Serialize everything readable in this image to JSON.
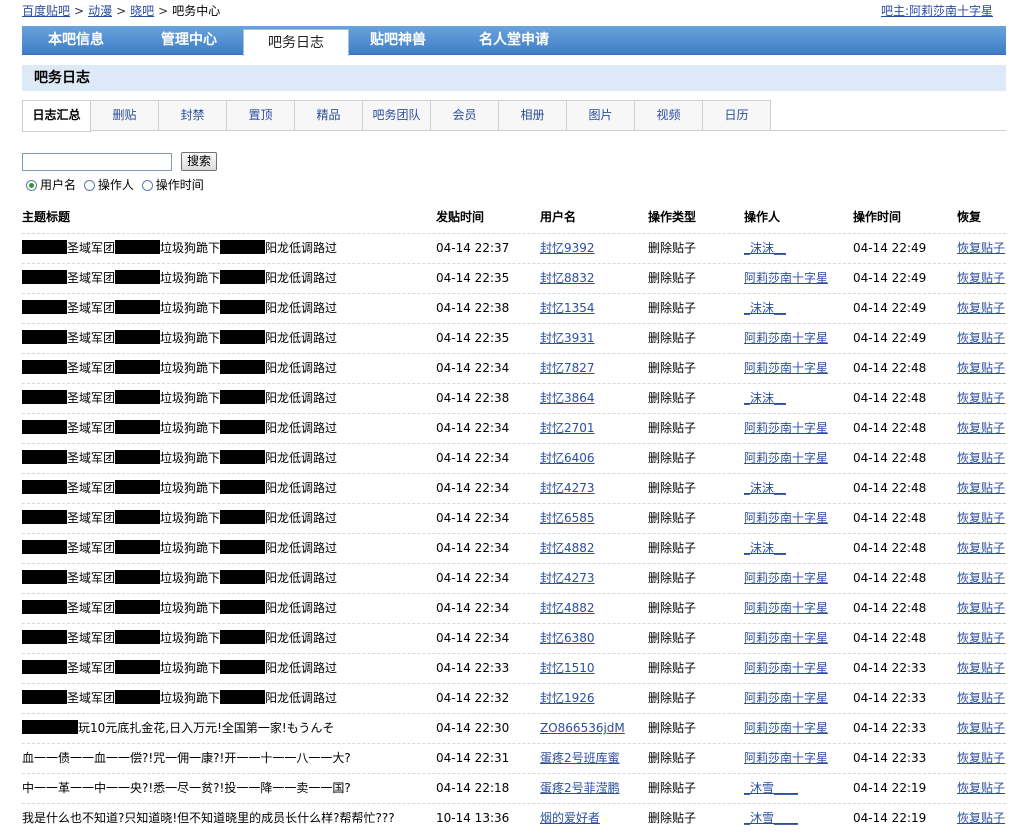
{
  "breadcrumb": {
    "items": [
      "百度贴吧",
      "动漫",
      "晓吧"
    ],
    "current": "吧务中心"
  },
  "owner": {
    "label": "吧主:",
    "name": "阿莉莎南十字星"
  },
  "nav_tabs": [
    "本吧信息",
    "管理中心",
    "吧务日志",
    "贴吧神兽",
    "名人堂申请"
  ],
  "section_title": "吧务日志",
  "sub_tabs": [
    "日志汇总",
    "删贴",
    "封禁",
    "置顶",
    "精品",
    "吧务团队",
    "会员",
    "相册",
    "图片",
    "视频",
    "日历"
  ],
  "search": {
    "button": "搜索",
    "value": ""
  },
  "radio_options": [
    "用户名",
    "操作人",
    "操作时间"
  ],
  "table": {
    "headers": [
      "主题标题",
      "发贴时间",
      "用户名",
      "操作类型",
      "操作人",
      "操作时间",
      "恢复"
    ],
    "rows": [
      {
        "title_parts": [
          "圣域军团",
          "垃圾狗跪下",
          "阳龙低调路过"
        ],
        "post_time": "04-14 22:37",
        "user": "封忆9392",
        "op_type": "删除贴子",
        "operator": "_沫沫__",
        "op_time": "04-14 22:49",
        "restore": "恢复贴子"
      },
      {
        "title_parts": [
          "圣域军团",
          "垃圾狗跪下",
          "阳龙低调路过"
        ],
        "post_time": "04-14 22:35",
        "user": "封忆8832",
        "op_type": "删除贴子",
        "operator": "阿莉莎南十字星",
        "op_time": "04-14 22:49",
        "restore": "恢复贴子"
      },
      {
        "title_parts": [
          "圣域军团",
          "垃圾狗跪下",
          "阳龙低调路过"
        ],
        "post_time": "04-14 22:38",
        "user": "封忆1354",
        "op_type": "删除贴子",
        "operator": "_沫沫__",
        "op_time": "04-14 22:49",
        "restore": "恢复贴子"
      },
      {
        "title_parts": [
          "圣域军团",
          "垃圾狗跪下",
          "阳龙低调路过"
        ],
        "post_time": "04-14 22:35",
        "user": "封忆3931",
        "op_type": "删除贴子",
        "operator": "阿莉莎南十字星",
        "op_time": "04-14 22:49",
        "restore": "恢复贴子"
      },
      {
        "title_parts": [
          "圣域军团",
          "垃圾狗跪下",
          "阳龙低调路过"
        ],
        "post_time": "04-14 22:34",
        "user": "封忆7827",
        "op_type": "删除贴子",
        "operator": "阿莉莎南十字星",
        "op_time": "04-14 22:48",
        "restore": "恢复贴子"
      },
      {
        "title_parts": [
          "圣域军团",
          "垃圾狗跪下",
          "阳龙低调路过"
        ],
        "post_time": "04-14 22:38",
        "user": "封忆3864",
        "op_type": "删除贴子",
        "operator": "_沫沫__",
        "op_time": "04-14 22:48",
        "restore": "恢复贴子"
      },
      {
        "title_parts": [
          "圣域军团",
          "垃圾狗跪下",
          "阳龙低调路过"
        ],
        "post_time": "04-14 22:34",
        "user": "封忆2701",
        "op_type": "删除贴子",
        "operator": "阿莉莎南十字星",
        "op_time": "04-14 22:48",
        "restore": "恢复贴子"
      },
      {
        "title_parts": [
          "圣域军团",
          "垃圾狗跪下",
          "阳龙低调路过"
        ],
        "post_time": "04-14 22:34",
        "user": "封忆6406",
        "op_type": "删除贴子",
        "operator": "阿莉莎南十字星",
        "op_time": "04-14 22:48",
        "restore": "恢复贴子"
      },
      {
        "title_parts": [
          "圣域军团",
          "垃圾狗跪下",
          "阳龙低调路过"
        ],
        "post_time": "04-14 22:34",
        "user": "封忆4273",
        "op_type": "删除贴子",
        "operator": "_沫沫__",
        "op_time": "04-14 22:48",
        "restore": "恢复贴子"
      },
      {
        "title_parts": [
          "圣域军团",
          "垃圾狗跪下",
          "阳龙低调路过"
        ],
        "post_time": "04-14 22:34",
        "user": "封忆6585",
        "op_type": "删除贴子",
        "operator": "阿莉莎南十字星",
        "op_time": "04-14 22:48",
        "restore": "恢复贴子"
      },
      {
        "title_parts": [
          "圣域军团",
          "垃圾狗跪下",
          "阳龙低调路过"
        ],
        "post_time": "04-14 22:34",
        "user": "封忆4882",
        "op_type": "删除贴子",
        "operator": "_沫沫__",
        "op_time": "04-14 22:48",
        "restore": "恢复贴子"
      },
      {
        "title_parts": [
          "圣域军团",
          "垃圾狗跪下",
          "阳龙低调路过"
        ],
        "post_time": "04-14 22:34",
        "user": "封忆4273",
        "op_type": "删除贴子",
        "operator": "阿莉莎南十字星",
        "op_time": "04-14 22:48",
        "restore": "恢复贴子"
      },
      {
        "title_parts": [
          "圣域军团",
          "垃圾狗跪下",
          "阳龙低调路过"
        ],
        "post_time": "04-14 22:34",
        "user": "封忆4882",
        "op_type": "删除贴子",
        "operator": "阿莉莎南十字星",
        "op_time": "04-14 22:48",
        "restore": "恢复贴子"
      },
      {
        "title_parts": [
          "圣域军团",
          "垃圾狗跪下",
          "阳龙低调路过"
        ],
        "post_time": "04-14 22:34",
        "user": "封忆6380",
        "op_type": "删除贴子",
        "operator": "阿莉莎南十字星",
        "op_time": "04-14 22:48",
        "restore": "恢复贴子"
      },
      {
        "title_parts": [
          "圣域军团",
          "垃圾狗跪下",
          "阳龙低调路过"
        ],
        "post_time": "04-14 22:33",
        "user": "封忆1510",
        "op_type": "删除贴子",
        "operator": "阿莉莎南十字星",
        "op_time": "04-14 22:33",
        "restore": "恢复贴子"
      },
      {
        "title_parts": [
          "圣域军团",
          "垃圾狗跪下",
          "阳龙低调路过"
        ],
        "post_time": "04-14 22:32",
        "user": "封忆1926",
        "op_type": "删除贴子",
        "operator": "阿莉莎南十字星",
        "op_time": "04-14 22:33",
        "restore": "恢复贴子"
      },
      {
        "title_parts": [
          "玩10元底扎金花,日入万元!全国第一家!もうんそ"
        ],
        "post_time": "04-14 22:30",
        "user": "ZO866536jdM",
        "op_type": "删除贴子",
        "operator": "阿莉莎南十字星",
        "op_time": "04-14 22:33",
        "restore": "恢复贴子"
      },
      {
        "title_parts": [
          "血一一债一一血一一偿?!咒一佣一康?!开一一十一一八一一大?"
        ],
        "post_time": "04-14 22:31",
        "user": "蛋疼2号班库蜜",
        "op_type": "删除贴子",
        "operator": "阿莉莎南十字星",
        "op_time": "04-14 22:33",
        "restore": "恢复贴子"
      },
      {
        "title_parts": [
          "中一一革一一中一一央?!悉一尽一贫?!投一一降一一卖一一国?"
        ],
        "post_time": "04-14 22:18",
        "user": "蛋疼2号菲滢鹏",
        "op_type": "删除贴子",
        "operator": "_沐雪____",
        "op_time": "04-14 22:19",
        "restore": "恢复贴子"
      },
      {
        "title_parts": [
          "我是什么也不知道?只知道晓!但不知道晓里的成员长什么样?帮帮忙???"
        ],
        "post_time": "10-14 13:36",
        "user": "烟的爱好者",
        "op_type": "删除贴子",
        "operator": "_沐雪____",
        "op_time": "04-14 22:19",
        "restore": "恢复贴子"
      }
    ]
  }
}
